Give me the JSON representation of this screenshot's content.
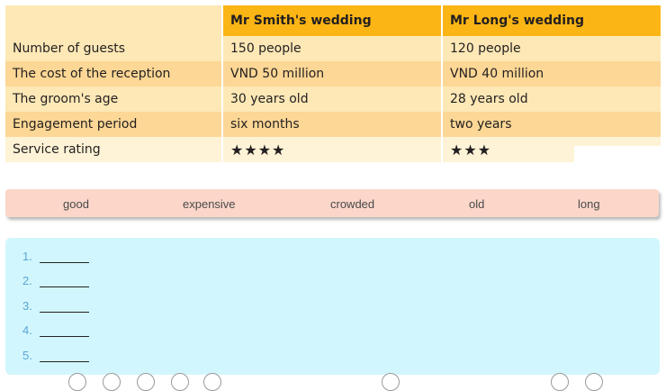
{
  "table": {
    "headers": [
      "",
      "Mr Smith's wedding",
      "Mr Long's wedding"
    ],
    "rows": [
      {
        "label": "Number of guests",
        "smith": "150 people",
        "long": "120 people"
      },
      {
        "label": "The cost of the reception",
        "smith": "VND 50 million",
        "long": "VND 40 million"
      },
      {
        "label": "The groom's age",
        "smith": "30 years old",
        "long": "28 years old"
      },
      {
        "label": "Engagement period",
        "smith": "six months",
        "long": "two years"
      },
      {
        "label": "Service rating",
        "smith": "★★★★",
        "long": "★★★"
      }
    ]
  },
  "word_box": {
    "words": [
      "good",
      "expensive",
      "crowded",
      "old",
      "long"
    ]
  },
  "answers": {
    "items": [
      {
        "number": "1."
      },
      {
        "number": "2."
      },
      {
        "number": "3."
      },
      {
        "number": "4."
      },
      {
        "number": "5."
      }
    ]
  },
  "colors": {
    "header": "#fbb514",
    "row_light": "#fde8b6",
    "row_dark": "#fcd795",
    "word_box": "#fbd6c9",
    "answer_panel": "#d2f6fd",
    "number_blue": "#5aa6d6"
  }
}
